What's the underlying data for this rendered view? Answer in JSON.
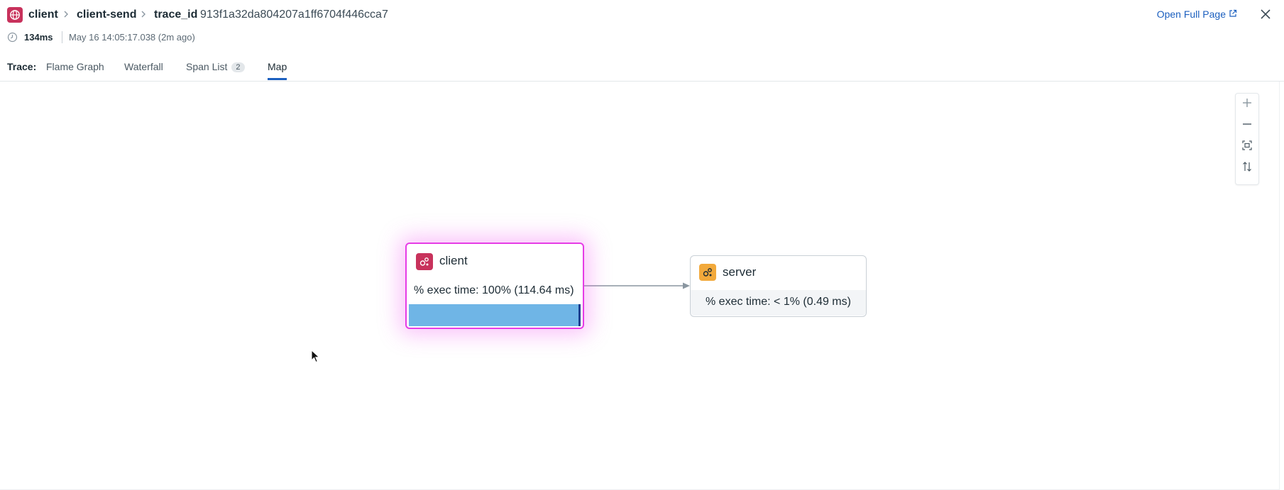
{
  "header": {
    "service": "client",
    "operation": "client-send",
    "trace_label": "trace_id",
    "trace_id": "913f1a32da804207a1ff6704f446cca7",
    "open_full_page": "Open Full Page"
  },
  "meta": {
    "duration": "134ms",
    "timestamp": "May 16 14:05:17.038 (2m ago)"
  },
  "tabs": {
    "label": "Trace:",
    "items": [
      {
        "label": "Flame Graph"
      },
      {
        "label": "Waterfall"
      },
      {
        "label": "Span List",
        "count": "2"
      },
      {
        "label": "Map",
        "active": true
      }
    ]
  },
  "map": {
    "nodes": [
      {
        "name": "client",
        "exec": "% exec time: 100% (114.64 ms)",
        "exec_fraction": 1.0,
        "color": "#c8325c",
        "selected": true
      },
      {
        "name": "server",
        "exec": "% exec time: < 1% (0.49 ms)",
        "color": "#f2a93b",
        "selected": false
      }
    ],
    "edges": [
      {
        "from": "client",
        "to": "server"
      }
    ]
  },
  "icons": {
    "app": "globe-icon",
    "node": "service-gears-icon",
    "clock": "clock-icon",
    "external": "external-link-icon",
    "close": "close-icon",
    "zoom_in": "plus-icon",
    "zoom_out": "minus-icon",
    "fit": "fit-to-screen-icon",
    "orientation": "swap-vertical-icon"
  },
  "colors": {
    "accent": "#1b5fbf",
    "selected_border": "#e63ce6",
    "exec_bar": "#6fb5e6"
  }
}
